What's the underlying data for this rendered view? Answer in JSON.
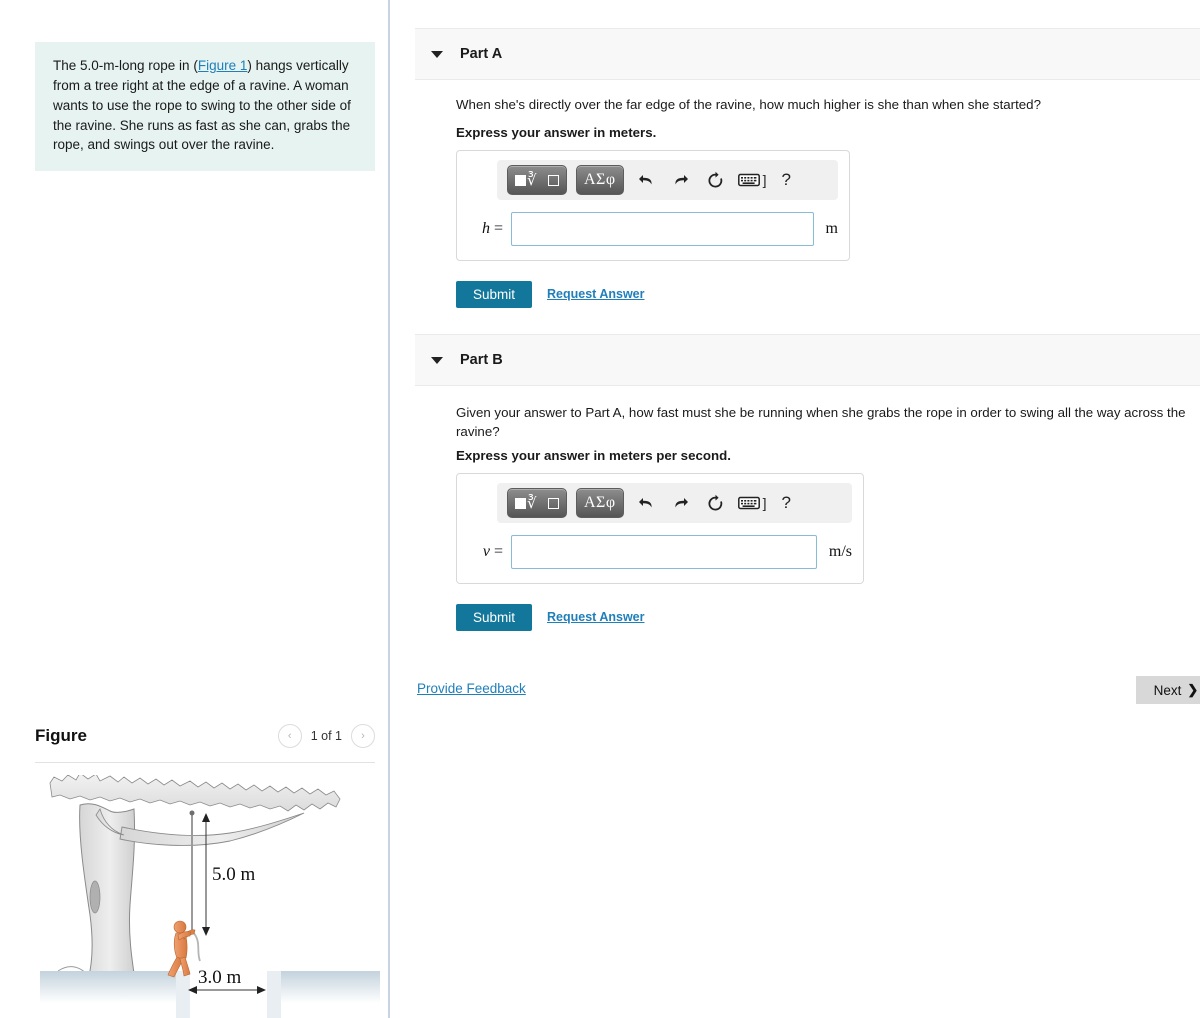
{
  "problem": {
    "text_before_link": "The 5.0-m-long rope in (",
    "figure_link": "Figure 1",
    "text_after_link": ") hangs vertically from a tree right at the edge of a ravine. A woman wants to use the rope to swing to the other side of the ravine. She runs as fast as she can, grabs the rope, and swings out over the ravine."
  },
  "parts": [
    {
      "id": "A",
      "title": "Part A",
      "question": "When she's directly over the far edge of the ravine, how much higher is she than when she started?",
      "instruction": "Express your answer in meters.",
      "variable": "h",
      "equals": " =",
      "value": "",
      "unit": "m",
      "submit_label": "Submit",
      "request_label": "Request Answer"
    },
    {
      "id": "B",
      "title": "Part B",
      "question": "Given your answer to Part A, how fast must she be running when she grabs the rope in order to swing all the way across the ravine?",
      "instruction": "Express your answer in meters per second.",
      "variable": "v",
      "equals": " =",
      "value": "",
      "unit": "m/s",
      "submit_label": "Submit",
      "request_label": "Request Answer"
    }
  ],
  "mathbar": {
    "template_label": "sqrt-template",
    "greek_label": "ΑΣφ",
    "undo_label": "undo-arrow",
    "redo_label": "redo-arrow",
    "reset_label": "reset-circle",
    "keyboard_bracket": "]",
    "help_label": "?"
  },
  "footer": {
    "feedback_label": "Provide Feedback",
    "next_label": "Next",
    "next_chevron": "❯"
  },
  "figure_panel": {
    "title": "Figure",
    "pager_prev": "‹",
    "pager_next": "›",
    "pager_label": "1 of 1",
    "rope_length_label": "5.0 m",
    "ravine_width_label": "3.0 m"
  },
  "colors": {
    "accent_teal": "#12779a",
    "link_blue": "#1f7fba",
    "problem_bg": "#e6f3f1",
    "input_border": "#86bcd6",
    "part_header_bg": "#f8f8f8",
    "next_bg": "#d8d8d8"
  }
}
